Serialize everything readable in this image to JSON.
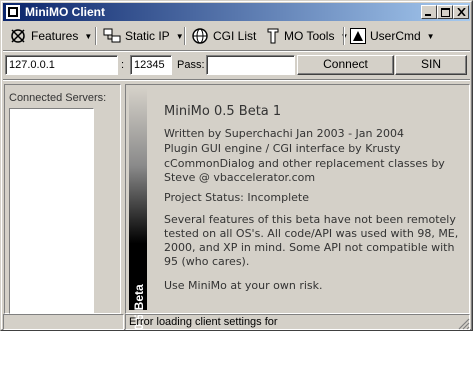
{
  "window": {
    "title": "MiniMO Client"
  },
  "toolbar": {
    "features": "Features",
    "static_ip": "Static IP",
    "cgi_list": "CGI List",
    "mo_tools": "MO Tools",
    "user_cmd": "UserCmd"
  },
  "connect": {
    "host": "127.0.0.1",
    "colon": ":",
    "port": "12345",
    "pass_label": "Pass:",
    "pass_value": "",
    "connect_label": "Connect",
    "sin_label": "SIN"
  },
  "servers": {
    "header": "Connected Servers:"
  },
  "about": {
    "banner": "MiniMo 0.5 Beta",
    "heading": "MiniMo 0.5 Beta 1",
    "lines": [
      "Written by Superchachi Jan 2003 - Jan 2004",
      "Plugin GUI engine / CGI interface by Krusty",
      "cCommonDialog and other replacement classes by Steve @ vbaccelerator.com",
      "Project Status: Incomplete",
      "Several features of this beta have not been remotely tested on all OS's. All code/API was used with 98, ME, 2000, and XP in mind. Some API not compatible with 95 (who cares).",
      "Use MiniMo at your own risk."
    ]
  },
  "status": {
    "message": "Error loading client settings for"
  }
}
